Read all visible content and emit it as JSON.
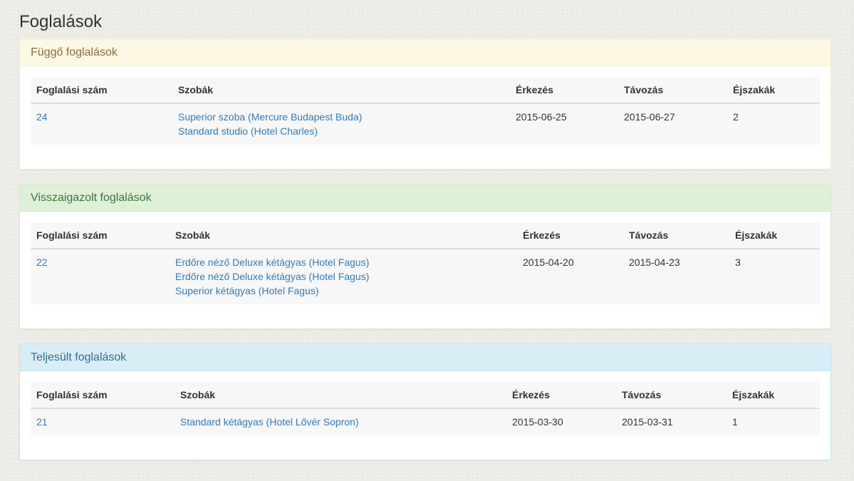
{
  "page": {
    "title": "Foglalások"
  },
  "columns": {
    "booking_number": "Foglalási szám",
    "rooms": "Szobák",
    "arrival": "Érkezés",
    "departure": "Távozás",
    "nights": "Éjszakák"
  },
  "pending": {
    "title": "Függő foglalások",
    "rows": [
      {
        "booking_number": "24",
        "rooms": [
          "Superior szoba (Mercure Budapest Buda)",
          "Standard studio (Hotel Charles)"
        ],
        "arrival": "2015-06-25",
        "departure": "2015-06-27",
        "nights": "2"
      }
    ]
  },
  "confirmed": {
    "title": "Visszaigazolt foglalások",
    "rows": [
      {
        "booking_number": "22",
        "rooms": [
          "Erdőre néző Deluxe kétágyas (Hotel Fagus)",
          "Erdőre néző Deluxe kétágyas (Hotel Fagus)",
          "Superior kétágyas (Hotel Fagus)"
        ],
        "arrival": "2015-04-20",
        "departure": "2015-04-23",
        "nights": "3"
      }
    ]
  },
  "completed": {
    "title": "Teljesült foglalások",
    "rows": [
      {
        "booking_number": "21",
        "rooms": [
          "Standard kétágyas (Hotel Lővér Sopron)"
        ],
        "arrival": "2015-03-30",
        "departure": "2015-03-31",
        "nights": "1"
      }
    ]
  }
}
